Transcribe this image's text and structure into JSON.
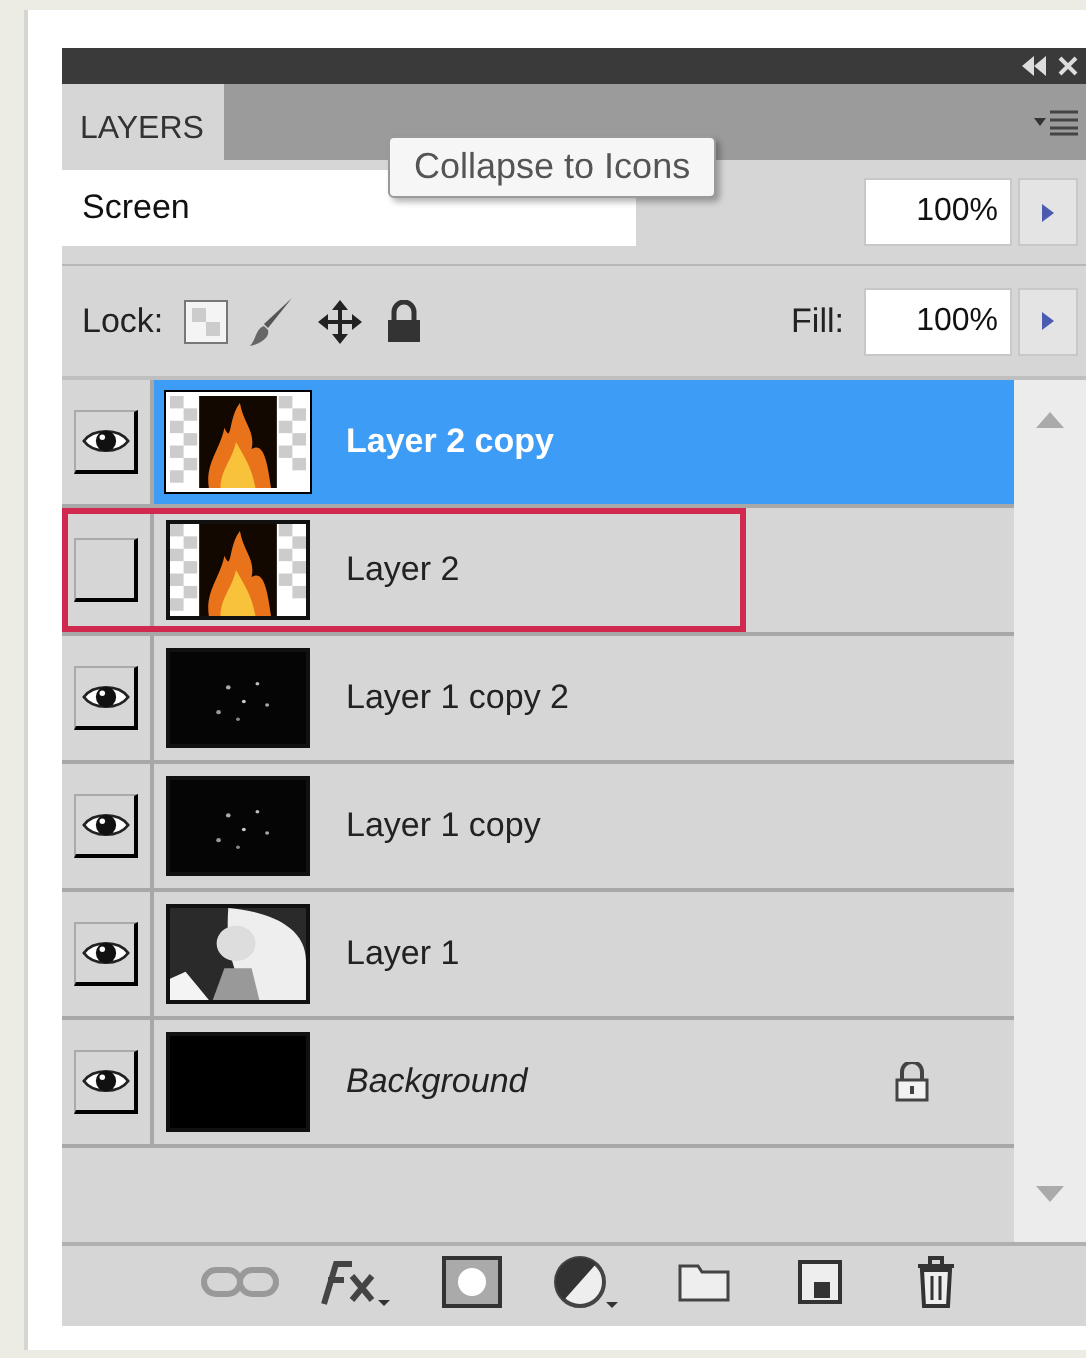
{
  "panel": {
    "tab": "LAYERS"
  },
  "tooltip": "Collapse to Icons",
  "blend_mode": {
    "value": "Screen"
  },
  "opacity": {
    "value": "100%"
  },
  "lock": {
    "label": "Lock:"
  },
  "fill": {
    "label": "Fill:",
    "value": "100%"
  },
  "layers": [
    {
      "name": "Layer 2 copy",
      "kind": "layer",
      "visible": true,
      "selected": true,
      "highlighted": false,
      "locked": false
    },
    {
      "name": "Layer 2",
      "kind": "layer",
      "visible": false,
      "selected": false,
      "highlighted": true,
      "locked": false
    },
    {
      "name": "Layer 1 copy 2",
      "kind": "layer",
      "visible": true,
      "selected": false,
      "highlighted": false,
      "locked": false
    },
    {
      "name": "Layer 1 copy",
      "kind": "layer",
      "visible": true,
      "selected": false,
      "highlighted": false,
      "locked": false
    },
    {
      "name": "Layer 1",
      "kind": "layer",
      "visible": true,
      "selected": false,
      "highlighted": false,
      "locked": false
    },
    {
      "name": "Background",
      "kind": "background",
      "visible": true,
      "selected": false,
      "highlighted": false,
      "locked": true
    }
  ]
}
